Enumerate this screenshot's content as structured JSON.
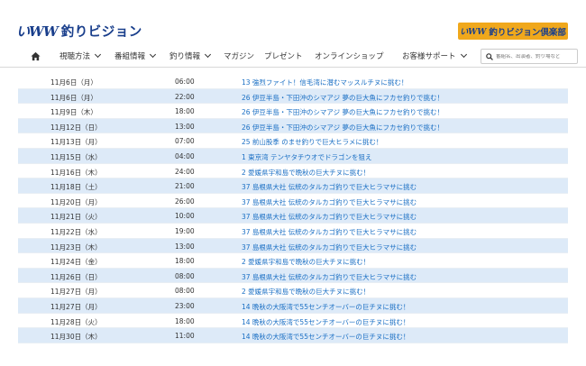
{
  "header": {
    "logo_mark": "いWW",
    "logo_text": "釣りビジョン",
    "club_mark": "いWW",
    "club_text": "釣りビジョン倶楽部"
  },
  "nav": {
    "items": [
      {
        "label": "視聴方法",
        "dropdown": true
      },
      {
        "label": "番組情報",
        "dropdown": true
      },
      {
        "label": "釣り情報",
        "dropdown": true
      },
      {
        "label": "マガジン",
        "dropdown": false
      },
      {
        "label": "プレゼント",
        "dropdown": false
      },
      {
        "label": "オンラインショップ",
        "dropdown": false
      },
      {
        "label": "お客様サポート",
        "dropdown": true
      }
    ],
    "search_placeholder": "番組名、出演者、釣り場など"
  },
  "schedule": [
    {
      "date": "11月6日（月）",
      "time": "06:00",
      "title": "13 強烈ファイト！信毛湾に潜むマッスルチヌに挑む！"
    },
    {
      "date": "11月6日（月）",
      "time": "22:00",
      "title": "26 伊豆半島・下田沖のシマアジ 夢の巨大魚にフカセ釣りで挑む！"
    },
    {
      "date": "11月9日（木）",
      "time": "18:00",
      "title": "26 伊豆半島・下田沖のシマアジ 夢の巨大魚にフカセ釣りで挑む！"
    },
    {
      "date": "11月12日（日）",
      "time": "13:00",
      "title": "26 伊豆半島・下田沖のシマアジ 夢の巨大魚にフカセ釣りで挑む！"
    },
    {
      "date": "11月13日（月）",
      "time": "07:00",
      "title": "25 前山股季 のませ釣りで巨大ヒラメに挑む！"
    },
    {
      "date": "11月15日（水）",
      "time": "04:00",
      "title": "1 東京湾 テンヤタチウオでドラゴンを狙え"
    },
    {
      "date": "11月16日（木）",
      "time": "24:00",
      "title": "2 愛媛県宇和島で晩秋の巨大チヌに挑む！"
    },
    {
      "date": "11月18日（土）",
      "time": "21:00",
      "title": "37 島根県大社 伝統のタルカゴ釣りで巨大ヒラマサに挑む"
    },
    {
      "date": "11月20日（月）",
      "time": "26:00",
      "title": "37 島根県大社 伝統のタルカゴ釣りで巨大ヒラマサに挑む"
    },
    {
      "date": "11月21日（火）",
      "time": "10:00",
      "title": "37 島根県大社 伝統のタルカゴ釣りで巨大ヒラマサに挑む"
    },
    {
      "date": "11月22日（水）",
      "time": "19:00",
      "title": "37 島根県大社 伝統のタルカゴ釣りで巨大ヒラマサに挑む"
    },
    {
      "date": "11月23日（木）",
      "time": "13:00",
      "title": "37 島根県大社 伝統のタルカゴ釣りで巨大ヒラマサに挑む"
    },
    {
      "date": "11月24日（金）",
      "time": "18:00",
      "title": "2 愛媛県宇和島で晩秋の巨大チヌに挑む！"
    },
    {
      "date": "11月26日（日）",
      "time": "08:00",
      "title": "37 島根県大社 伝統のタルカゴ釣りで巨大ヒラマサに挑む"
    },
    {
      "date": "11月27日（月）",
      "time": "08:00",
      "title": "2 愛媛県宇和島で晩秋の巨大チヌに挑む！"
    },
    {
      "date": "11月27日（月）",
      "time": "23:00",
      "title": "14 晩秋の大阪湾で55センチオーバーの巨チヌに挑む！"
    },
    {
      "date": "11月28日（火）",
      "time": "18:00",
      "title": "14 晩秋の大阪湾で55センチオーバーの巨チヌに挑む！"
    },
    {
      "date": "11月30日（木）",
      "time": "11:00",
      "title": "14 晩秋の大阪湾で55センチオーバーの巨チヌに挑む！"
    }
  ],
  "colors": {
    "brand": "#1a3f8c",
    "club_bg": "#f0a81c",
    "row_alt": "#ddeaf8",
    "link": "#1a6fc4"
  }
}
